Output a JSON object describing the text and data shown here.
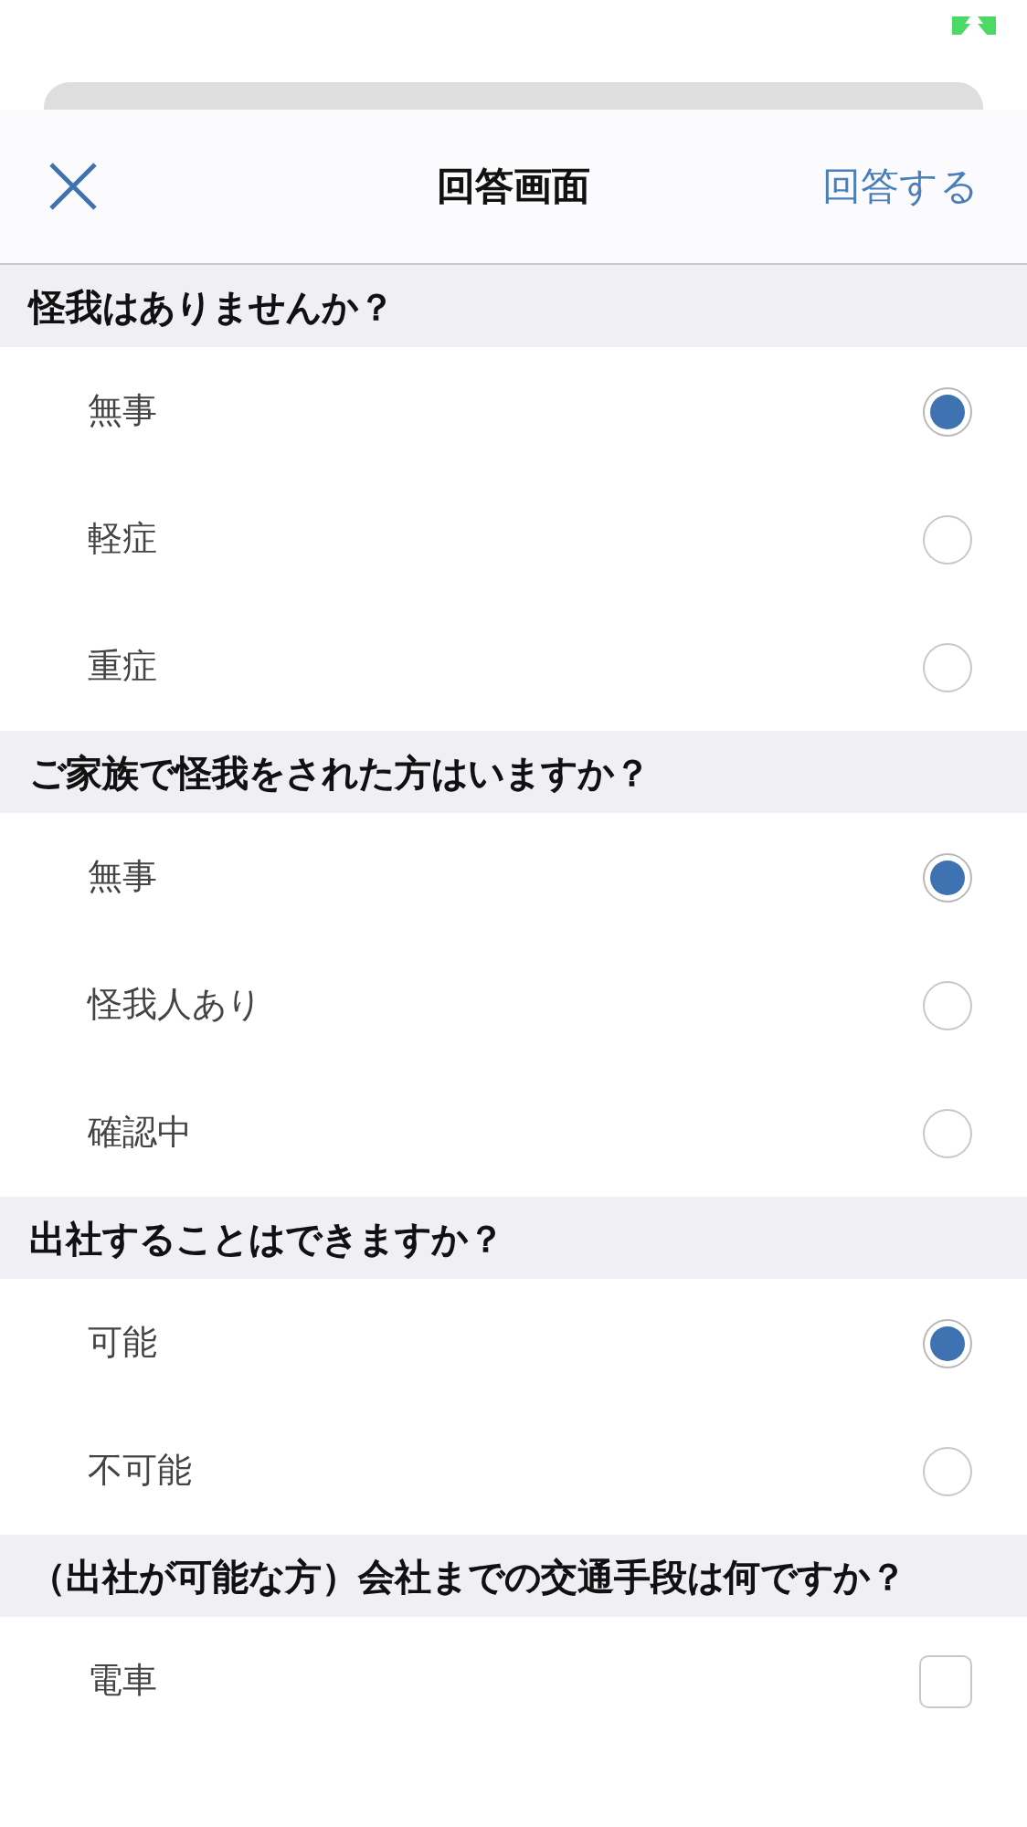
{
  "header": {
    "title": "回答画面",
    "submit": "回答する"
  },
  "questions": [
    {
      "text": "怪我はありませんか？",
      "kind": "single",
      "options": [
        {
          "label": "無事",
          "selected": true
        },
        {
          "label": "軽症",
          "selected": false
        },
        {
          "label": "重症",
          "selected": false
        }
      ]
    },
    {
      "text": "ご家族で怪我をされた方はいますか？",
      "kind": "single",
      "options": [
        {
          "label": "無事",
          "selected": true
        },
        {
          "label": "怪我人あり",
          "selected": false
        },
        {
          "label": "確認中",
          "selected": false
        }
      ]
    },
    {
      "text": "出社することはできますか？",
      "kind": "single",
      "options": [
        {
          "label": "可能",
          "selected": true
        },
        {
          "label": "不可能",
          "selected": false
        }
      ]
    },
    {
      "text": "（出社が可能な方）会社までの交通手段は何ですか？",
      "kind": "multiple",
      "options": [
        {
          "label": "電車",
          "selected": false
        }
      ]
    }
  ]
}
